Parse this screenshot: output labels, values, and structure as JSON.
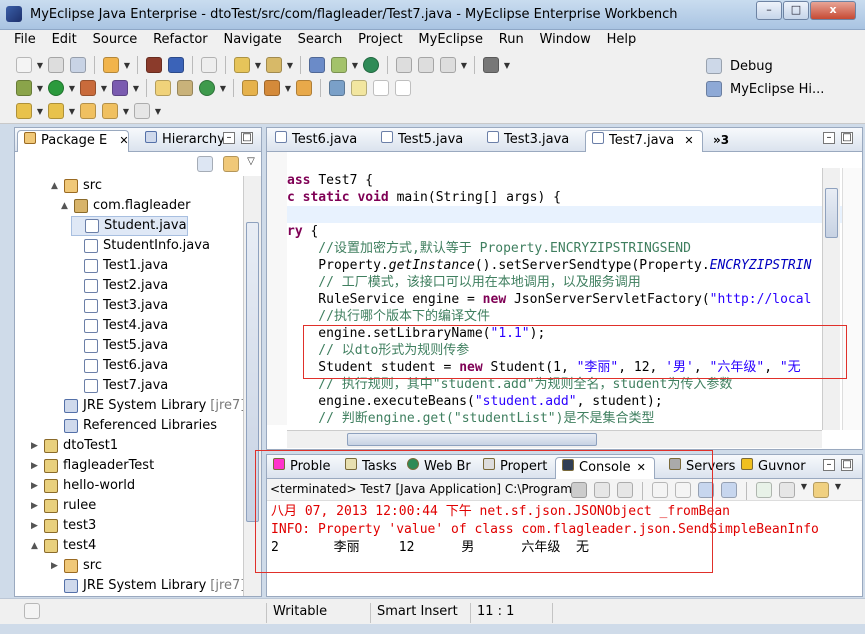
{
  "window": {
    "title": "MyEclipse Java Enterprise - dtoTest/src/com/flagleader/Test7.java - MyEclipse Enterprise Workbench",
    "minimize": "–",
    "maximize": "□",
    "close": "x"
  },
  "menu": [
    "File",
    "Edit",
    "Source",
    "Refactor",
    "Navigate",
    "Search",
    "Project",
    "MyEclipse",
    "Run",
    "Window",
    "Help"
  ],
  "perspectives": {
    "debug": "Debug",
    "myeclipse": "MyEclipse Hi..."
  },
  "package_explorer": {
    "tabs": [
      "Package E",
      "Hierarchy"
    ],
    "items": [
      {
        "label": "src",
        "icon": "source-folder-icon"
      },
      {
        "label": "com.flagleader",
        "icon": "package-icon"
      },
      {
        "label": "Student.java",
        "icon": "java-file-icon"
      },
      {
        "label": "StudentInfo.java",
        "icon": "java-file-icon"
      },
      {
        "label": "Test1.java",
        "icon": "java-file-icon"
      },
      {
        "label": "Test2.java",
        "icon": "java-file-icon"
      },
      {
        "label": "Test3.java",
        "icon": "java-file-icon"
      },
      {
        "label": "Test4.java",
        "icon": "java-file-icon"
      },
      {
        "label": "Test5.java",
        "icon": "java-file-icon"
      },
      {
        "label": "Test6.java",
        "icon": "java-file-icon"
      },
      {
        "label": "Test7.java",
        "icon": "java-file-icon"
      },
      {
        "label": "JRE System Library",
        "suffix": "[jre7]",
        "icon": "library-icon"
      },
      {
        "label": "Referenced Libraries",
        "icon": "library-icon"
      },
      {
        "label": "dtoTest1",
        "icon": "project-icon"
      },
      {
        "label": "flagleaderTest",
        "icon": "project-icon"
      },
      {
        "label": "hello-world",
        "icon": "project-icon"
      },
      {
        "label": "rulee",
        "icon": "project-icon"
      },
      {
        "label": "test3",
        "icon": "project-icon"
      },
      {
        "label": "test4",
        "icon": "project-icon"
      },
      {
        "label": "src",
        "icon": "source-folder-icon"
      },
      {
        "label": "JRE System Library",
        "suffix": "[jre7]",
        "icon": "library-icon"
      }
    ]
  },
  "editor": {
    "tabs": [
      "Test6.java",
      "Test5.java",
      "Test3.java",
      "Test7.java"
    ],
    "overflow": "»3",
    "lines": [
      "ass Test7 {",
      "c static void main(String[] args) {",
      "",
      "ry {",
      "    //设置加密方式,默认等于 Property.ENCRYZIPSTRINGSEND",
      "    Property.getInstance().setServerSendtype(Property.ENCRYZIPSTRIN",
      "    // 工厂模式，该接口可以用在本地调用，以及服务调用",
      "    RuleService engine = new JsonServerServletFactory(\"http://local",
      "    //执行哪个版本下的编译文件",
      "    engine.setLibraryName(\"1.1\");",
      "    // 以dto形式为规则传参",
      "    Student student = new Student(1, \"李丽\", 12, '男', \"六年级\", \"无",
      "    // 执行规则，其中\"student.add\"为规则全名，student为传入参数",
      "    engine.executeBeans(\"student.add\", student);",
      "    // 判断engine.get(\"studentList\")是不是集合类型"
    ]
  },
  "console": {
    "tabs": [
      "Proble",
      "Tasks",
      "Web Br",
      "Propert",
      "Console",
      "Servers",
      "Guvnor"
    ],
    "header": "<terminated> Test7 [Java Application] C:\\Program F",
    "output": [
      "八月 07, 2013 12:00:44 下午 net.sf.json.JSONObject _fromBean",
      "INFO: Property 'value' of class com.flagleader.json.SendSimpleBeanInfo",
      "2       李丽     12      男      六年级  无"
    ]
  },
  "status": {
    "mode": "Writable",
    "insert": "Smart Insert",
    "position": "11 : 1"
  },
  "colors": {
    "accent": "#e0302a",
    "keyword": "#7f0055",
    "comment": "#3f7f5f",
    "string": "#2a00ff",
    "error": "#e00000"
  }
}
